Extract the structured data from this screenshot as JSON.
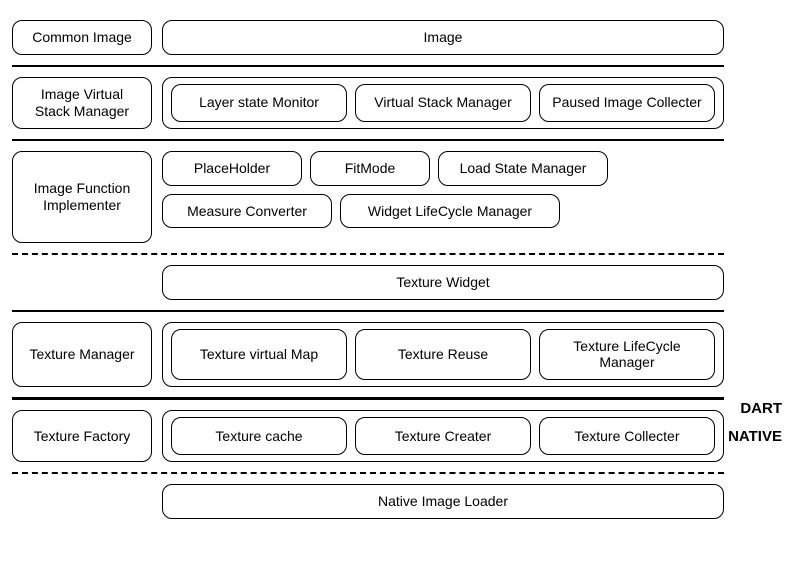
{
  "labels": {
    "dart": "DART",
    "native": "NATIVE"
  },
  "rows": {
    "r1": {
      "left": "Common Image",
      "right": "Image"
    },
    "r2": {
      "left": "Image Virtual Stack Manager",
      "items": [
        "Layer state Monitor",
        "Virtual Stack Manager",
        "Paused Image Collecter"
      ]
    },
    "r3": {
      "left": "Image Function Implementer",
      "line1": [
        "PlaceHolder",
        "FitMode",
        "Load State Manager"
      ],
      "line2": [
        "Measure Converter",
        "Widget LifeCycle Manager"
      ]
    },
    "r4": {
      "right": "Texture Widget"
    },
    "r5": {
      "left": "Texture Manager",
      "items": [
        "Texture virtual Map",
        "Texture Reuse",
        "Texture LifeCycle Manager"
      ]
    },
    "r6": {
      "left": "Texture Factory",
      "items": [
        "Texture cache",
        "Texture Creater",
        "Texture  Collecter"
      ]
    },
    "r7": {
      "right": "Native  Image Loader"
    }
  }
}
